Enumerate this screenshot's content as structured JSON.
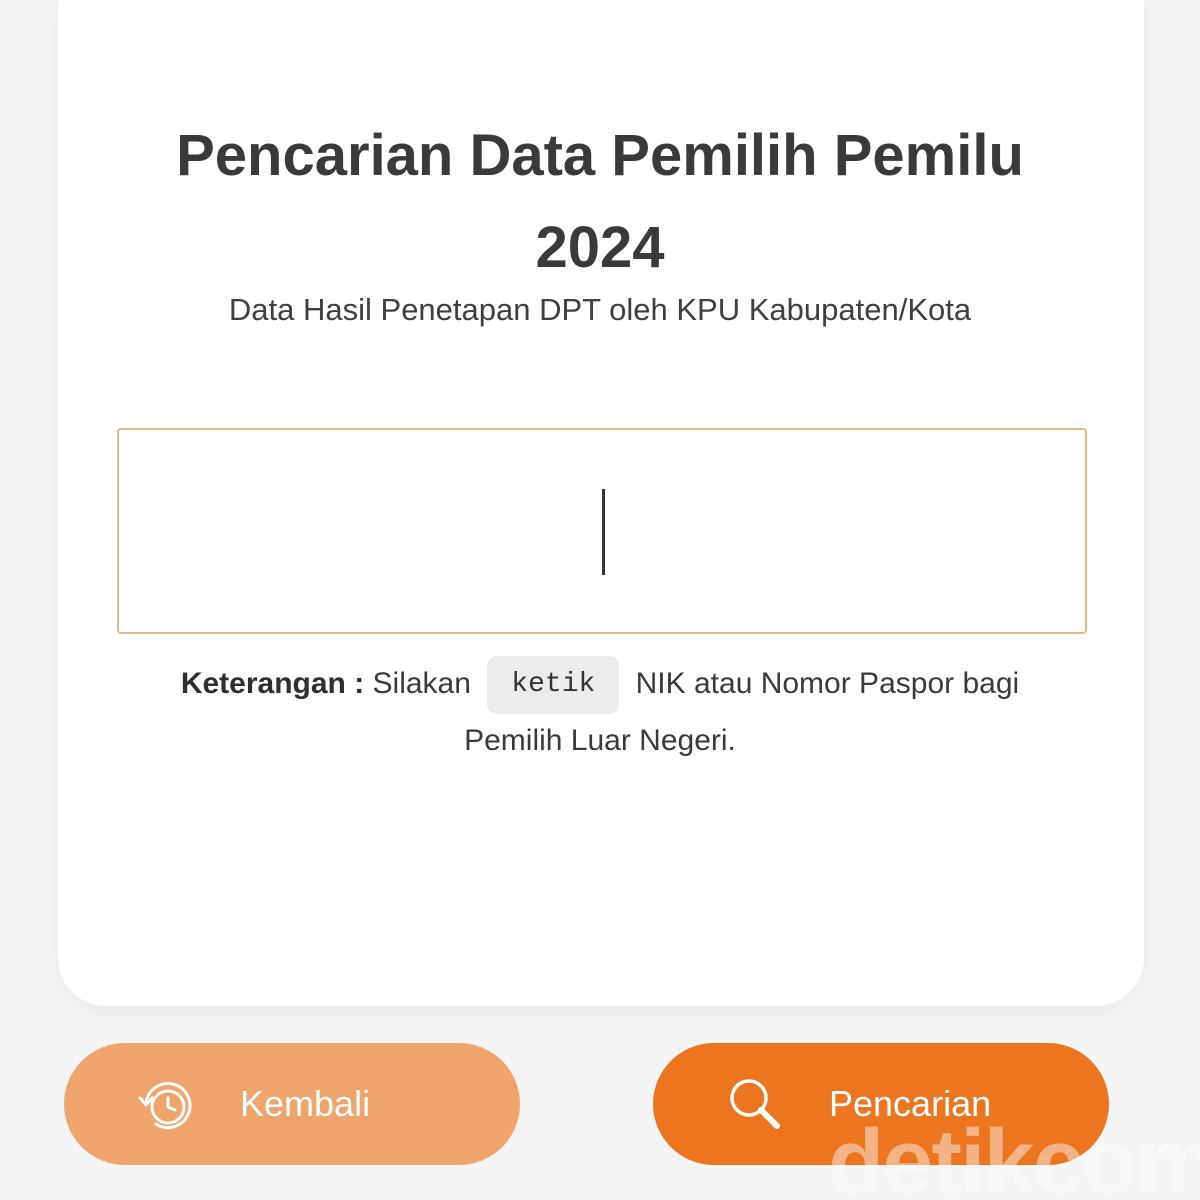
{
  "header": {
    "title_line1": "Pencarian Data Pemilih Pemilu",
    "title_line2": "2024",
    "subtitle": "Data Hasil Penetapan DPT oleh KPU Kabupaten/Kota"
  },
  "search": {
    "value": "",
    "placeholder": ""
  },
  "note": {
    "label": "Keterangan :",
    "text_before": "Silakan",
    "code": "ketik",
    "text_after": "NIK atau Nomor Paspor bagi Pemilih Luar Negeri."
  },
  "buttons": {
    "back_label": "Kembali",
    "back_icon": "history-clock-icon",
    "search_label": "Pencarian",
    "search_icon": "search-icon"
  },
  "watermark": "detikcom",
  "colors": {
    "primary": "#ec7520",
    "secondary": "#efa46b",
    "input_border": "#e3b88f"
  }
}
